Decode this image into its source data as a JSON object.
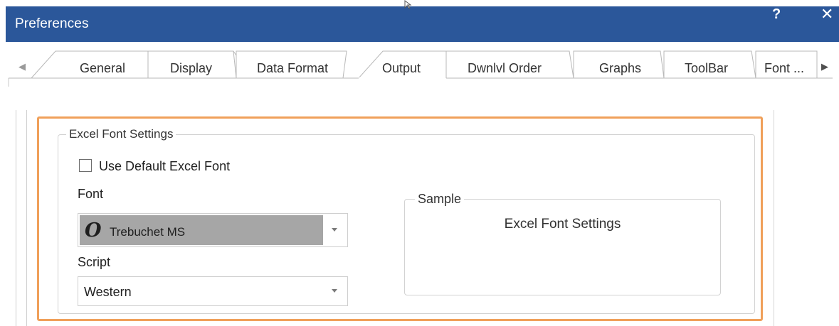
{
  "window": {
    "title": "Preferences",
    "help_label": "?",
    "close_label": "✕"
  },
  "tabs": {
    "items": [
      {
        "label": "General"
      },
      {
        "label": "Display"
      },
      {
        "label": "Data Format"
      },
      {
        "label": "Output",
        "selected": true
      },
      {
        "label": "Dwnlvl Order"
      },
      {
        "label": "Graphs"
      },
      {
        "label": "ToolBar"
      },
      {
        "label": "Font ..."
      }
    ],
    "scroll_left": "◀",
    "scroll_right": "▶"
  },
  "excel_font_settings": {
    "group_title": "Excel Font Settings",
    "use_default_label": "Use Default Excel Font",
    "use_default_checked": false,
    "font_label": "Font",
    "font_value": "Trebuchet MS",
    "font_icon": "O",
    "script_label": "Script",
    "script_value": "Western",
    "sample_title": "Sample",
    "sample_text": "Excel Font Settings"
  },
  "colors": {
    "titlebar": "#2b579a",
    "highlight": "#f0a05a",
    "font_combo_selected": "#a6a6a6"
  }
}
